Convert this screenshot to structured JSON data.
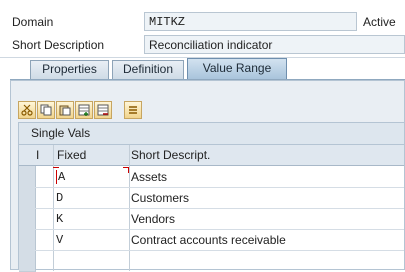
{
  "fields": {
    "domain_label": "Domain",
    "domain_value": "MITKZ",
    "status": "Active",
    "short_desc_label": "Short Description",
    "short_desc_value": "Reconciliation indicator"
  },
  "tabs": [
    {
      "label": "Properties",
      "active": false
    },
    {
      "label": "Definition",
      "active": false
    },
    {
      "label": "Value Range",
      "active": true
    }
  ],
  "toolbar": {
    "icons": [
      "cut-icon",
      "copy-icon",
      "paste-icon",
      "insert-row-icon",
      "delete-row-icon",
      "select-all-icon"
    ]
  },
  "table": {
    "title": "Single Vals",
    "columns": [
      "I",
      "Fixed",
      "Short Descript."
    ],
    "rows": [
      {
        "fixed": "A",
        "desc": "Assets"
      },
      {
        "fixed": "D",
        "desc": "Customers"
      },
      {
        "fixed": "K",
        "desc": "Vendors"
      },
      {
        "fixed": "V",
        "desc": "Contract accounts receivable"
      }
    ]
  }
}
